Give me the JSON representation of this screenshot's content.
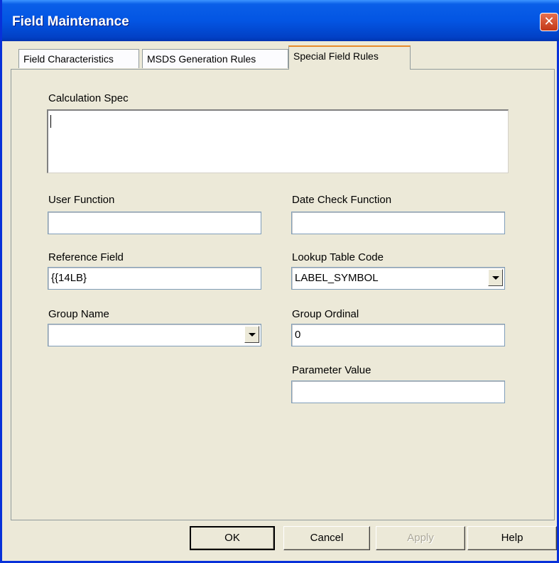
{
  "window": {
    "title": "Field Maintenance",
    "close_icon": "close-icon"
  },
  "tabs": [
    {
      "label": "Field Characteristics",
      "active": false
    },
    {
      "label": "MSDS Generation Rules",
      "active": false
    },
    {
      "label": "Special Field Rules",
      "active": true
    }
  ],
  "form": {
    "calculation_spec": {
      "label": "Calculation Spec",
      "value": ""
    },
    "user_function": {
      "label": "User Function",
      "value": ""
    },
    "date_check_function": {
      "label": "Date Check Function",
      "value": ""
    },
    "reference_field": {
      "label": "Reference Field",
      "value": "{{14LB}"
    },
    "lookup_table_code": {
      "label": "Lookup Table Code",
      "value": "LABEL_SYMBOL"
    },
    "group_name": {
      "label": "Group Name",
      "value": ""
    },
    "group_ordinal": {
      "label": "Group Ordinal",
      "value": "0"
    },
    "parameter_value": {
      "label": "Parameter Value",
      "value": ""
    }
  },
  "buttons": {
    "ok": "OK",
    "cancel": "Cancel",
    "apply": "Apply",
    "help": "Help"
  }
}
